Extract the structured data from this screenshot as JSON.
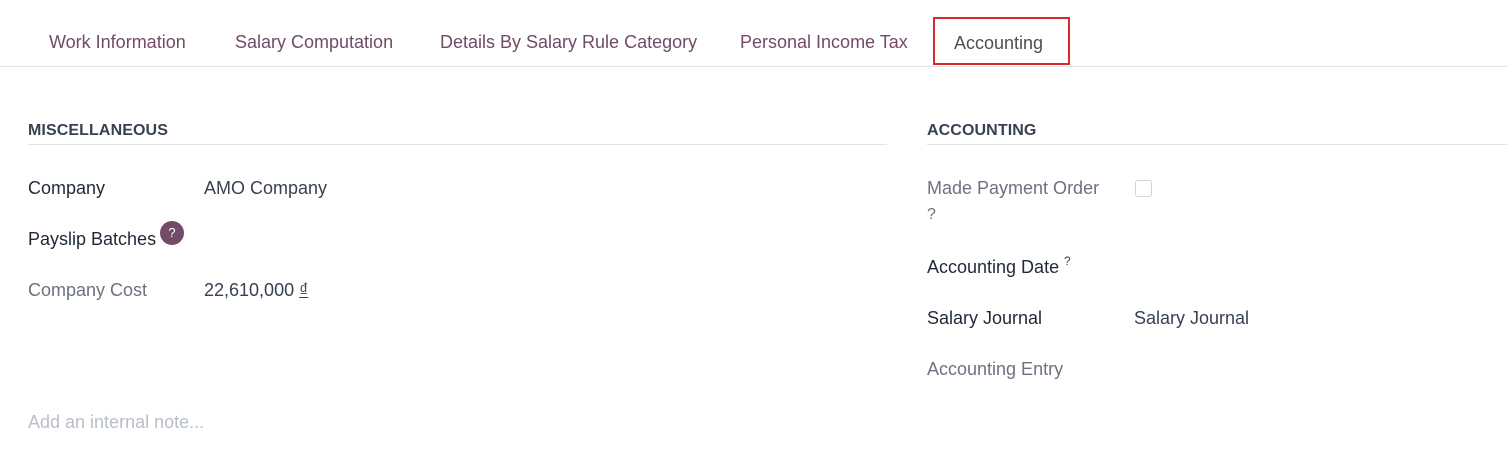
{
  "tabs": [
    {
      "label": "Work Information"
    },
    {
      "label": "Salary Computation"
    },
    {
      "label": "Details By Salary Rule Category"
    },
    {
      "label": "Personal Income Tax"
    },
    {
      "label": "Accounting",
      "active": true
    }
  ],
  "misc": {
    "title": "MISCELLANEOUS",
    "company_label": "Company",
    "company_value": "AMO Company",
    "payslip_batches_label": "Payslip Batches",
    "payslip_help": "?",
    "company_cost_label": "Company Cost",
    "company_cost_amount": "22,610,000",
    "company_cost_currency": "₫"
  },
  "accounting": {
    "title": "ACCOUNTING",
    "made_payment_order_label": "Made Payment Order",
    "made_payment_order_q": "?",
    "made_payment_order_checked": false,
    "accounting_date_label": "Accounting Date",
    "accounting_date_help": "?",
    "salary_journal_label": "Salary Journal",
    "salary_journal_value": "Salary Journal",
    "accounting_entry_label": "Accounting Entry"
  },
  "note": {
    "placeholder": "Add an internal note..."
  },
  "colors": {
    "brand": "#714B67",
    "highlight_border": "#d62b2b"
  }
}
